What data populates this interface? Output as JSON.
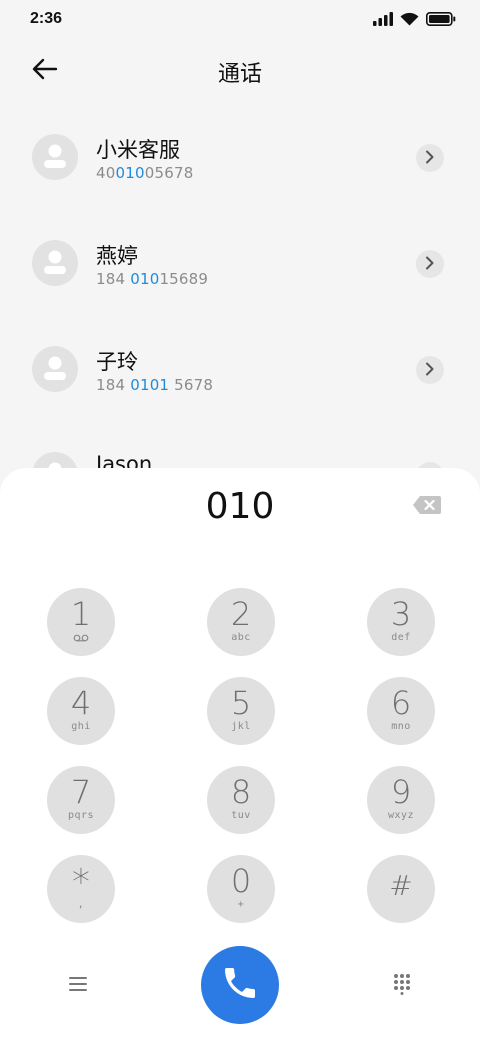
{
  "status_bar": {
    "time": "2:36"
  },
  "header": {
    "title": "通话"
  },
  "contacts": [
    {
      "name": "小米客服",
      "number_pre": "40",
      "number_match": "010",
      "number_post": "05678"
    },
    {
      "name": "燕婷",
      "number_pre": "184 ",
      "number_match": "010",
      "number_post": "15689"
    },
    {
      "name": "子玲",
      "number_pre": "184 ",
      "number_match": "0101",
      "number_post": " 5678"
    },
    {
      "name": "Jason",
      "number_pre": "",
      "number_match": "",
      "number_post": ""
    }
  ],
  "dialer": {
    "dialed_number": "010",
    "keys": [
      {
        "digit": "1",
        "letters": ""
      },
      {
        "digit": "2",
        "letters": "abc"
      },
      {
        "digit": "3",
        "letters": "def"
      },
      {
        "digit": "4",
        "letters": "ghi"
      },
      {
        "digit": "5",
        "letters": "jkl"
      },
      {
        "digit": "6",
        "letters": "mno"
      },
      {
        "digit": "7",
        "letters": "pqrs"
      },
      {
        "digit": "8",
        "letters": "tuv"
      },
      {
        "digit": "9",
        "letters": "wxyz"
      },
      {
        "digit": "*",
        "letters": ","
      },
      {
        "digit": "0",
        "letters": "+"
      },
      {
        "digit": "#",
        "letters": ""
      }
    ]
  },
  "icons": {
    "back": "arrow-left-icon",
    "detail": "chevron-right-icon",
    "backspace": "backspace-icon",
    "voicemail": "voicemail-icon",
    "menu": "menu-icon",
    "call": "phone-icon",
    "keypad": "dialpad-icon"
  },
  "colors": {
    "accent": "#2c7be5",
    "match_highlight": "#1e8bdb",
    "key_background": "#e0e0e0",
    "page_background": "#f5f5f5"
  }
}
